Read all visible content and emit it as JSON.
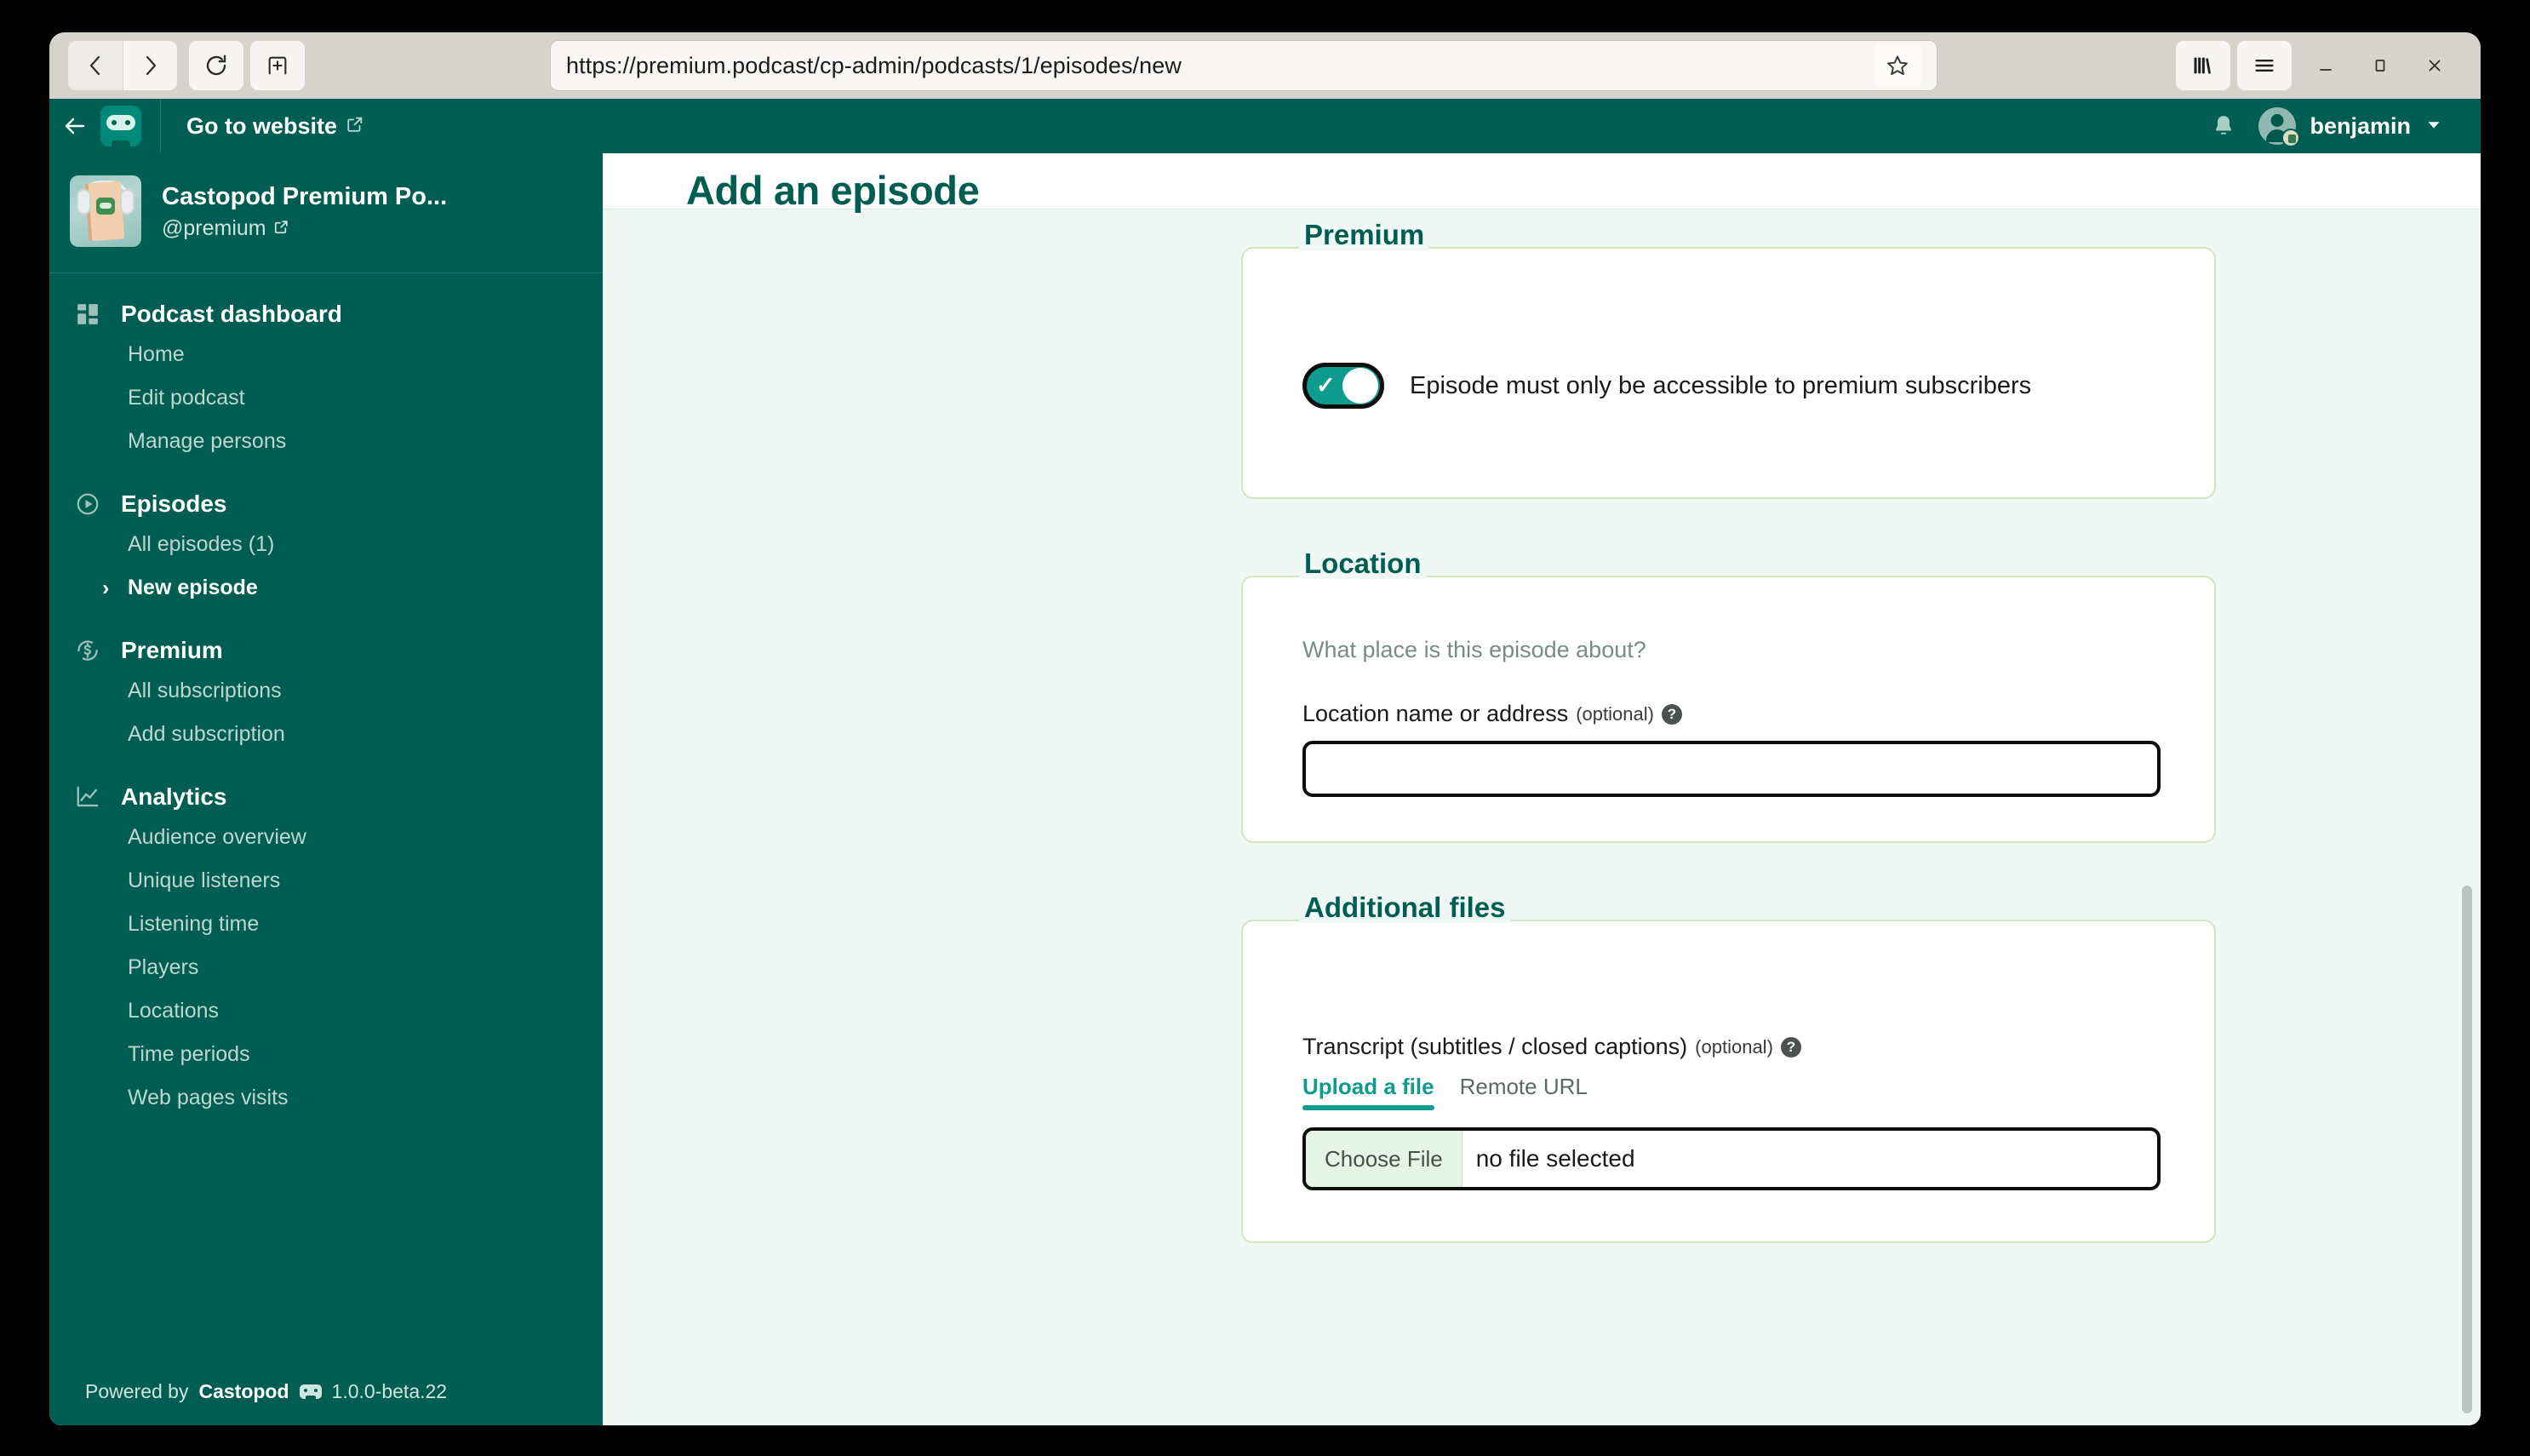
{
  "browser": {
    "url": "https://premium.podcast/cp-admin/podcasts/1/episodes/new",
    "back_icon": "back-arrow-icon",
    "forward_icon": "forward-arrow-icon",
    "reload_icon": "reload-icon",
    "newtab_icon": "new-tab-icon",
    "bookmark_icon": "star-icon",
    "library_icon": "library-icon",
    "menu_icon": "hamburger-menu-icon",
    "minimize_icon": "minimize-icon",
    "maximize_icon": "maximize-icon",
    "close_icon": "close-icon"
  },
  "app_header": {
    "back_label": "back",
    "logo_name": "castopod-logo",
    "go_to_website": "Go to website",
    "external_link_icon": "external-link-icon",
    "notifications_icon": "bell-icon",
    "username": "benjamin",
    "chevron_icon": "chevron-down-icon"
  },
  "sidebar": {
    "podcast": {
      "title": "Castopod Premium Po...",
      "handle": "@premium",
      "cover_name": "podcast-cover-image"
    },
    "sections": [
      {
        "title": "Podcast dashboard",
        "icon": "dashboard-grid-icon",
        "items": [
          {
            "label": "Home",
            "active": false
          },
          {
            "label": "Edit podcast",
            "active": false
          },
          {
            "label": "Manage persons",
            "active": false
          }
        ]
      },
      {
        "title": "Episodes",
        "icon": "play-circle-icon",
        "items": [
          {
            "label": "All episodes (1)",
            "active": false
          },
          {
            "label": "New episode",
            "active": true
          }
        ]
      },
      {
        "title": "Premium",
        "icon": "subscription-dollar-icon",
        "items": [
          {
            "label": "All subscriptions",
            "active": false
          },
          {
            "label": "Add subscription",
            "active": false
          }
        ]
      },
      {
        "title": "Analytics",
        "icon": "line-chart-icon",
        "items": [
          {
            "label": "Audience overview",
            "active": false
          },
          {
            "label": "Unique listeners",
            "active": false
          },
          {
            "label": "Listening time",
            "active": false
          },
          {
            "label": "Players",
            "active": false
          },
          {
            "label": "Locations",
            "active": false
          },
          {
            "label": "Time periods",
            "active": false
          },
          {
            "label": "Web pages visits",
            "active": false
          }
        ]
      }
    ],
    "footer": {
      "powered_by": "Powered by",
      "brand": "Castopod",
      "version": "1.0.0-beta.22"
    }
  },
  "main": {
    "page_title": "Add an episode",
    "premium_section": {
      "legend": "Premium",
      "toggle_label": "Episode must only be accessible to premium subscribers",
      "toggle_on": true
    },
    "location_section": {
      "legend": "Location",
      "help_text": "What place is this episode about?",
      "field_label": "Location name or address",
      "optional": "(optional)",
      "field_value": "",
      "field_placeholder": ""
    },
    "additional_files_section": {
      "legend": "Additional files",
      "transcript_label": "Transcript (subtitles / closed captions)",
      "optional": "(optional)",
      "tabs": [
        {
          "label": "Upload a file",
          "active": true
        },
        {
          "label": "Remote URL",
          "active": false
        }
      ],
      "choose_file_button": "Choose File",
      "file_status": "no file selected"
    }
  },
  "colors": {
    "brand_dark": "#005d52",
    "brand_teal": "#0f9b8e",
    "page_bg": "#f0f8f6",
    "card_border": "#cfe6c6",
    "highlight": "#e3f4e0"
  }
}
